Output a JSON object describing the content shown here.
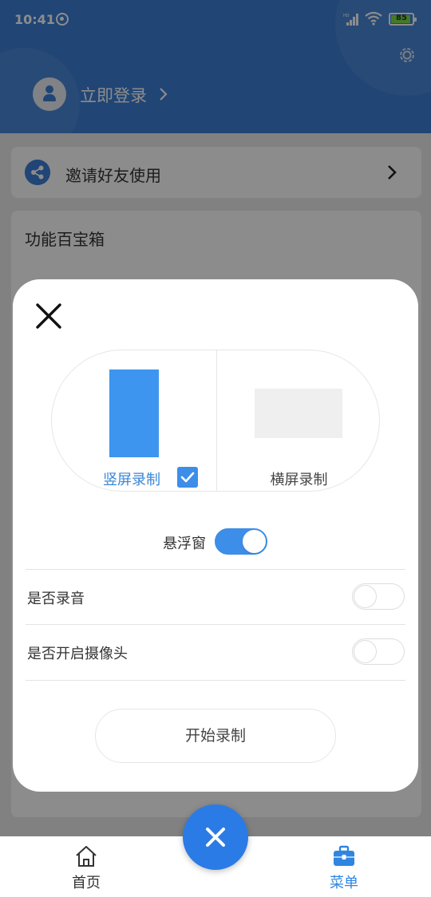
{
  "status_bar": {
    "time": "10:41",
    "battery_level": "85",
    "network_badge": "HD",
    "icons": [
      "sync-icon",
      "signal-icon",
      "wifi-icon",
      "battery-icon"
    ]
  },
  "header": {
    "login_text": "立即登录",
    "settings_icon": "gear-icon"
  },
  "invite": {
    "label": "邀请好友使用"
  },
  "toolbox": {
    "title": "功能百宝箱"
  },
  "dialog": {
    "orientation": {
      "portrait_label": "竖屏录制",
      "landscape_label": "横屏录制",
      "selected": "portrait"
    },
    "floating_window": {
      "label": "悬浮窗",
      "enabled": true
    },
    "settings": [
      {
        "label": "是否录音",
        "enabled": false
      },
      {
        "label": "是否开启摄像头",
        "enabled": false
      }
    ],
    "start_button": "开始录制"
  },
  "bottom_nav": {
    "items": [
      {
        "label": "首页",
        "icon": "home-icon",
        "active": false
      },
      {
        "label": "菜单",
        "icon": "briefcase-icon",
        "active": true
      }
    ]
  },
  "colors": {
    "primary": "#3d7fd6",
    "accent": "#3d8ee8",
    "active_nav": "#2e86e0"
  }
}
